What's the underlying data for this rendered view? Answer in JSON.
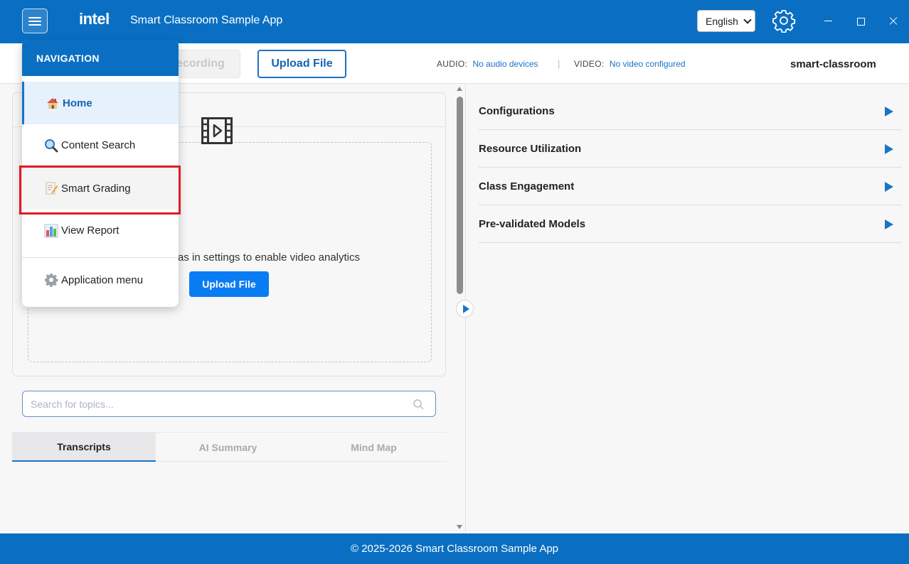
{
  "header": {
    "logo_text": "intel",
    "logo_mark": ".",
    "app_title": "Smart Classroom Sample App",
    "language": "English"
  },
  "toolbar": {
    "record_label": "Start Recording",
    "record_visible": "ecording",
    "upload_label": "Upload File",
    "audio_label": "AUDIO:",
    "audio_value": "No audio devices",
    "separator": "|",
    "video_label": "VIDEO:",
    "video_value": "No video configured",
    "project_name": "smart-classroom"
  },
  "video_panel": {
    "message_visible": "as in settings to enable video analytics",
    "upload_label": "Upload File"
  },
  "search": {
    "placeholder": "Search for topics..."
  },
  "tabs": [
    {
      "label": "Transcripts",
      "active": true
    },
    {
      "label": "AI Summary",
      "active": false
    },
    {
      "label": "Mind Map",
      "active": false
    }
  ],
  "accordion": [
    {
      "label": "Configurations"
    },
    {
      "label": "Resource Utilization"
    },
    {
      "label": "Class Engagement"
    },
    {
      "label": "Pre-validated Models"
    }
  ],
  "navigation": {
    "title": "NAVIGATION",
    "items": [
      {
        "label": "Home",
        "icon": "home-icon",
        "active": true
      },
      {
        "label": "Content Search",
        "icon": "magnifier-icon"
      },
      {
        "label": "Smart Grading",
        "icon": "memo-icon",
        "highlighted": true
      },
      {
        "label": "View Report",
        "icon": "bar-chart-icon"
      },
      {
        "label": "Application menu",
        "icon": "gear-icon"
      }
    ]
  },
  "footer": {
    "text": "© 2025-2026 Smart Classroom Sample App"
  },
  "colors": {
    "brand_blue": "#0a6fc2",
    "accent_blue": "#1a73c7",
    "button_blue": "#0a7cf3",
    "highlight_red": "#e01b24"
  }
}
